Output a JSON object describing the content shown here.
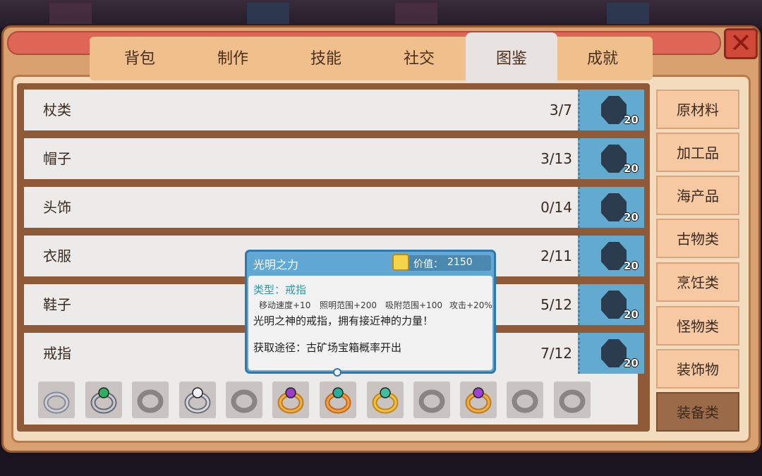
{
  "tabs": [
    {
      "label": "背包"
    },
    {
      "label": "制作"
    },
    {
      "label": "技能"
    },
    {
      "label": "社交"
    },
    {
      "label": "图鉴",
      "active": true
    },
    {
      "label": "成就"
    }
  ],
  "close_label": "✕",
  "rows": [
    {
      "label": "杖类",
      "count": "3/7",
      "slot_num": "20"
    },
    {
      "label": "帽子",
      "count": "3/13",
      "slot_num": "20"
    },
    {
      "label": "头饰",
      "count": "0/14",
      "slot_num": "20"
    },
    {
      "label": "衣服",
      "count": "2/11",
      "slot_num": "20"
    },
    {
      "label": "鞋子",
      "count": "5/12",
      "slot_num": "20"
    },
    {
      "label": "戒指",
      "count": "7/12",
      "slot_num": "20"
    }
  ],
  "categories": [
    {
      "label": "原材料"
    },
    {
      "label": "加工品"
    },
    {
      "label": "海产品"
    },
    {
      "label": "古物类"
    },
    {
      "label": "烹饪类"
    },
    {
      "label": "怪物类"
    },
    {
      "label": "装饰物"
    },
    {
      "label": "装备类",
      "active": true
    }
  ],
  "tooltip": {
    "title": "光明之力",
    "price_label": "价值：",
    "price_value": "2150",
    "type": "类型：戒指",
    "stats": [
      "移动速度+10",
      "照明范围+200",
      "吸附范围+100",
      "攻击+20%"
    ],
    "description": "光明之神的戒指，拥有接近神的力量！",
    "source": "获取途径：古矿场宝箱概率开出"
  },
  "ring_items": [
    {
      "icon": "silver-ring-icon"
    },
    {
      "icon": "emerald-ring-icon"
    },
    {
      "icon": "unknown-ring-silhouette-icon"
    },
    {
      "icon": "diamond-ring-icon"
    },
    {
      "icon": "unknown-ring-silhouette-icon"
    },
    {
      "icon": "amethyst-ring-icon"
    },
    {
      "icon": "light-ring-icon"
    },
    {
      "icon": "topaz-ring-icon"
    },
    {
      "icon": "unknown-ring-silhouette-icon"
    },
    {
      "icon": "purple-gem-ring-icon"
    },
    {
      "icon": "unknown-ring-silhouette-icon"
    },
    {
      "icon": "unknown-ring-silhouette-icon"
    }
  ],
  "colors": {
    "frame": "#d9a070",
    "title_bar": "#de6656",
    "slot_blue": "#62aad0",
    "tooltip_blue": "#62a8d4",
    "active_category": "#9b6a48"
  }
}
